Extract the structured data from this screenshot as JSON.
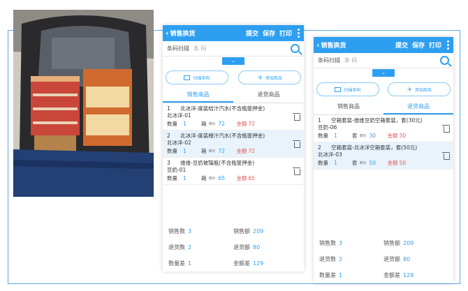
{
  "colors": {
    "primary": "#2e9ff0",
    "money": "#e05a5a",
    "frame": "#5aa9e6"
  },
  "screens": [
    {
      "title": "销售换货",
      "actions": [
        "提交",
        "保存",
        "打印"
      ],
      "scan_label": "条码扫描",
      "scan_placeholder": "条 码",
      "buttons": [
        "扫描条码",
        "添加商品"
      ],
      "tabs": [
        "销售商品",
        "退货商品"
      ],
      "active_tab": 0,
      "items": [
        {
          "idx": "1",
          "name": "北冰洋-度装桔汁汽水(不含瓶筐押金)",
          "code": "北冰洋-01",
          "qty_label": "数量",
          "qty": "1",
          "unit": "箱",
          "price_label": "单价",
          "price": "72",
          "amount_label": "金额",
          "amount": "72",
          "highlight": false
        },
        {
          "idx": "2",
          "name": "北冰洋-度装橙汁汽水(不含瓶筐押金)",
          "code": "北冰洋-02",
          "qty_label": "数量",
          "qty": "1",
          "unit": "箱",
          "price_label": "单价",
          "price": "72",
          "amount_label": "金额",
          "amount": "72",
          "highlight": true
        },
        {
          "idx": "3",
          "name": "维维-豆奶玻璃瓶(不含瓶筐押金)",
          "code": "豆奶-01",
          "qty_label": "数量",
          "qty": "1",
          "unit": "箱",
          "price_label": "单价",
          "price": "65",
          "amount_label": "金额",
          "amount": "65",
          "highlight": false
        }
      ],
      "summary": [
        {
          "label": "销售数",
          "value": "3"
        },
        {
          "label": "销售额",
          "value": "209"
        },
        {
          "label": "退货数",
          "value": "2"
        },
        {
          "label": "退货额",
          "value": "80"
        },
        {
          "label": "数量差",
          "value": "1"
        },
        {
          "label": "金额差",
          "value": "129"
        }
      ]
    },
    {
      "title": "销售换货",
      "actions": [
        "提交",
        "保存",
        "打印"
      ],
      "scan_label": "条码扫描",
      "scan_placeholder": "条 码",
      "buttons": [
        "扫描条码",
        "添加商品"
      ],
      "tabs": [
        "销售商品",
        "退货商品"
      ],
      "active_tab": 1,
      "items": [
        {
          "idx": "1",
          "name": "空箱套装-维维豆奶空箱套装，套(30元)",
          "code": "豆奶-06",
          "qty_label": "数量",
          "qty": "1",
          "unit": "套",
          "price_label": "单价",
          "price": "30",
          "amount_label": "金额",
          "amount": "30",
          "highlight": false
        },
        {
          "idx": "2",
          "name": "空箱套装-北冰洋空箱套装，套(50元)",
          "code": "北冰洋-03",
          "qty_label": "数量",
          "qty": "1",
          "unit": "套",
          "price_label": "单价",
          "price": "50",
          "amount_label": "金额",
          "amount": "50",
          "highlight": true
        }
      ],
      "summary": [
        {
          "label": "销售数",
          "value": "3"
        },
        {
          "label": "销售额",
          "value": "209"
        },
        {
          "label": "退货数",
          "value": "2"
        },
        {
          "label": "退货额",
          "value": "80"
        },
        {
          "label": "数量差",
          "value": "1"
        },
        {
          "label": "金额差",
          "value": "129"
        }
      ]
    }
  ]
}
